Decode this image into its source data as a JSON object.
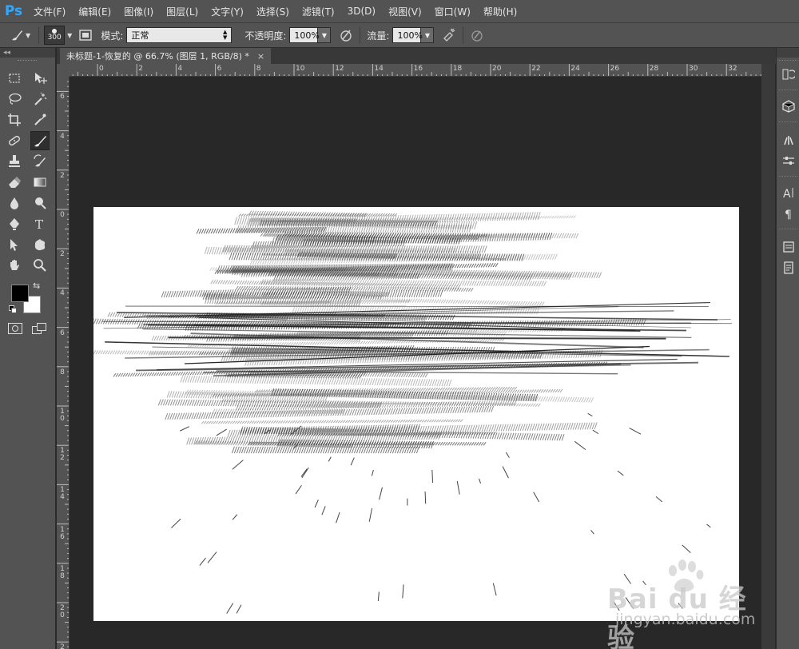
{
  "app": {
    "logo": "Ps"
  },
  "menu": [
    "文件(F)",
    "编辑(E)",
    "图像(I)",
    "图层(L)",
    "文字(Y)",
    "选择(S)",
    "滤镜(T)",
    "3D(D)",
    "视图(V)",
    "窗口(W)",
    "帮助(H)"
  ],
  "options": {
    "brush_size": "300",
    "mode_label": "模式:",
    "mode_value": "正常",
    "opacity_label": "不透明度:",
    "opacity_value": "100%",
    "flow_label": "流量:",
    "flow_value": "100%"
  },
  "document": {
    "tab_title": "未标题-1-恢复的 @ 66.7% (图层 1, RGB/8) *",
    "close_glyph": "×"
  },
  "ruler_top": [
    "0",
    "2",
    "4",
    "6",
    "8",
    "10",
    "12",
    "14",
    "16",
    "18",
    "20",
    "22",
    "24",
    "26",
    "28",
    "30",
    "32"
  ],
  "ruler_left": [
    "6",
    "4",
    "2",
    "0",
    "2",
    "4",
    "6",
    "8",
    "10",
    "12",
    "14",
    "16",
    "18",
    "20",
    "22"
  ],
  "toolbox": {
    "collapse_glyph": "◂◂"
  },
  "watermark": {
    "logo_text": "Bai du 经验",
    "url": "jingyan.baidu.com"
  },
  "colors": {
    "accent": "#31a8ff",
    "panel": "#535353",
    "workspace": "#282828",
    "canvas": "#ffffff"
  }
}
